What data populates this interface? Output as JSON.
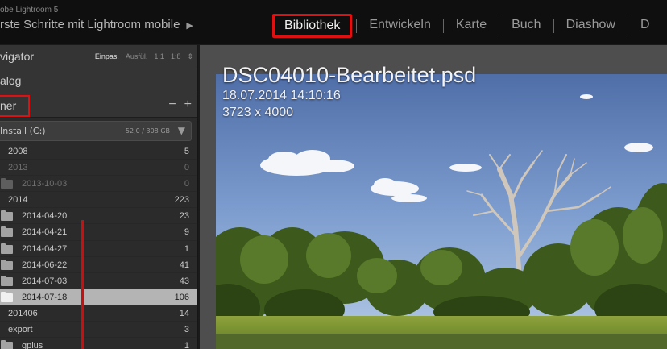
{
  "topbar": {
    "app_name": "obe Lightroom 5",
    "catalog": "rste Schritte mit Lightroom mobile",
    "catalog_arrow": "▶",
    "modules": [
      {
        "label": "Bibliothek",
        "active": true
      },
      {
        "label": "Entwickeln",
        "active": false
      },
      {
        "label": "Karte",
        "active": false
      },
      {
        "label": "Buch",
        "active": false
      },
      {
        "label": "Diashow",
        "active": false
      },
      {
        "label": "D",
        "active": false
      }
    ]
  },
  "left_panel": {
    "navigator": {
      "title": "vigator",
      "zoom_options": [
        "Einpas.",
        "Ausfül.",
        "1:1",
        "1:8"
      ],
      "zoom_selected": "Einpas.",
      "zoom_arrow": "⇕"
    },
    "catalog": {
      "title": "alog"
    },
    "folders": {
      "title": "ner",
      "remove_label": "−",
      "add_label": "+",
      "volume": {
        "name": "Install (C:)",
        "size": "52,0 / 308 GB",
        "arrow": "▼"
      },
      "items": [
        {
          "name": "2008",
          "count": "5",
          "level": 0,
          "icon": false,
          "dim": false,
          "selected": false
        },
        {
          "name": "2013",
          "count": "0",
          "level": 0,
          "icon": false,
          "dim": true,
          "selected": false
        },
        {
          "name": "2013-10-03",
          "count": "0",
          "level": 1,
          "icon": true,
          "dim": true,
          "selected": false
        },
        {
          "name": "2014",
          "count": "223",
          "level": 0,
          "icon": false,
          "dim": false,
          "selected": false
        },
        {
          "name": "2014-04-20",
          "count": "23",
          "level": 1,
          "icon": true,
          "dim": false,
          "selected": false
        },
        {
          "name": "2014-04-21",
          "count": "9",
          "level": 1,
          "icon": true,
          "dim": false,
          "selected": false
        },
        {
          "name": "2014-04-27",
          "count": "1",
          "level": 1,
          "icon": true,
          "dim": false,
          "selected": false
        },
        {
          "name": "2014-06-22",
          "count": "41",
          "level": 1,
          "icon": true,
          "dim": false,
          "selected": false
        },
        {
          "name": "2014-07-03",
          "count": "43",
          "level": 1,
          "icon": true,
          "dim": false,
          "selected": false
        },
        {
          "name": "2014-07-18",
          "count": "106",
          "level": 1,
          "icon": true,
          "dim": false,
          "selected": true
        },
        {
          "name": "201406",
          "count": "14",
          "level": 0,
          "icon": false,
          "dim": false,
          "selected": false
        },
        {
          "name": "export",
          "count": "3",
          "level": 0,
          "icon": false,
          "dim": false,
          "selected": false
        },
        {
          "name": "gplus",
          "count": "1",
          "level": 1,
          "icon": true,
          "dim": false,
          "selected": false
        }
      ]
    }
  },
  "photo_info": {
    "filename": "DSC04010-Bearbeitet.psd",
    "datetime": "18.07.2014 14:10:16",
    "dimensions": "3723 x 4000"
  },
  "colors": {
    "highlight_red": "#d11111",
    "selected_row": "#b4b4b4",
    "panel_bg": "#2b2b2b"
  }
}
